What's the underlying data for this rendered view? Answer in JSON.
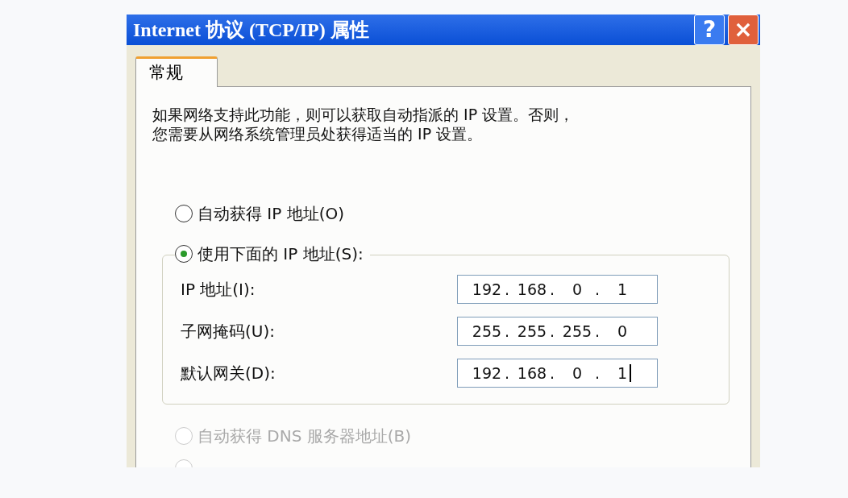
{
  "window": {
    "title": "Internet 协议 (TCP/IP) 属性",
    "buttons": [
      {
        "kind": "help",
        "label": "?"
      },
      {
        "kind": "close",
        "label": "×"
      }
    ]
  },
  "tabs": [
    {
      "label": "常规",
      "selected": true
    }
  ],
  "description": [
    "如果网络支持此功能，则可以获取自动指派的 IP 设置。否则，",
    "您需要从网络系统管理员处获得适当的 IP 设置。"
  ],
  "ip_mode": [
    {
      "label": "自动获得 IP 地址(O)",
      "selected": false,
      "disabled": false
    },
    {
      "label": "使用下面的 IP 地址(S):",
      "selected": true,
      "disabled": false
    }
  ],
  "ip_fields": [
    {
      "label": "IP 地址(I):",
      "octets": [
        "192",
        "168",
        "0",
        "1"
      ],
      "caret": false
    },
    {
      "label": "子网掩码(U):",
      "octets": [
        "255",
        "255",
        "255",
        "0"
      ],
      "caret": false
    },
    {
      "label": "默认网关(D):",
      "octets": [
        "192",
        "168",
        "0",
        "1"
      ],
      "caret": true
    }
  ],
  "separator": ".",
  "dns_mode": [
    {
      "label": "自动获得 DNS 服务器地址(B)",
      "selected": false,
      "disabled": true
    }
  ]
}
